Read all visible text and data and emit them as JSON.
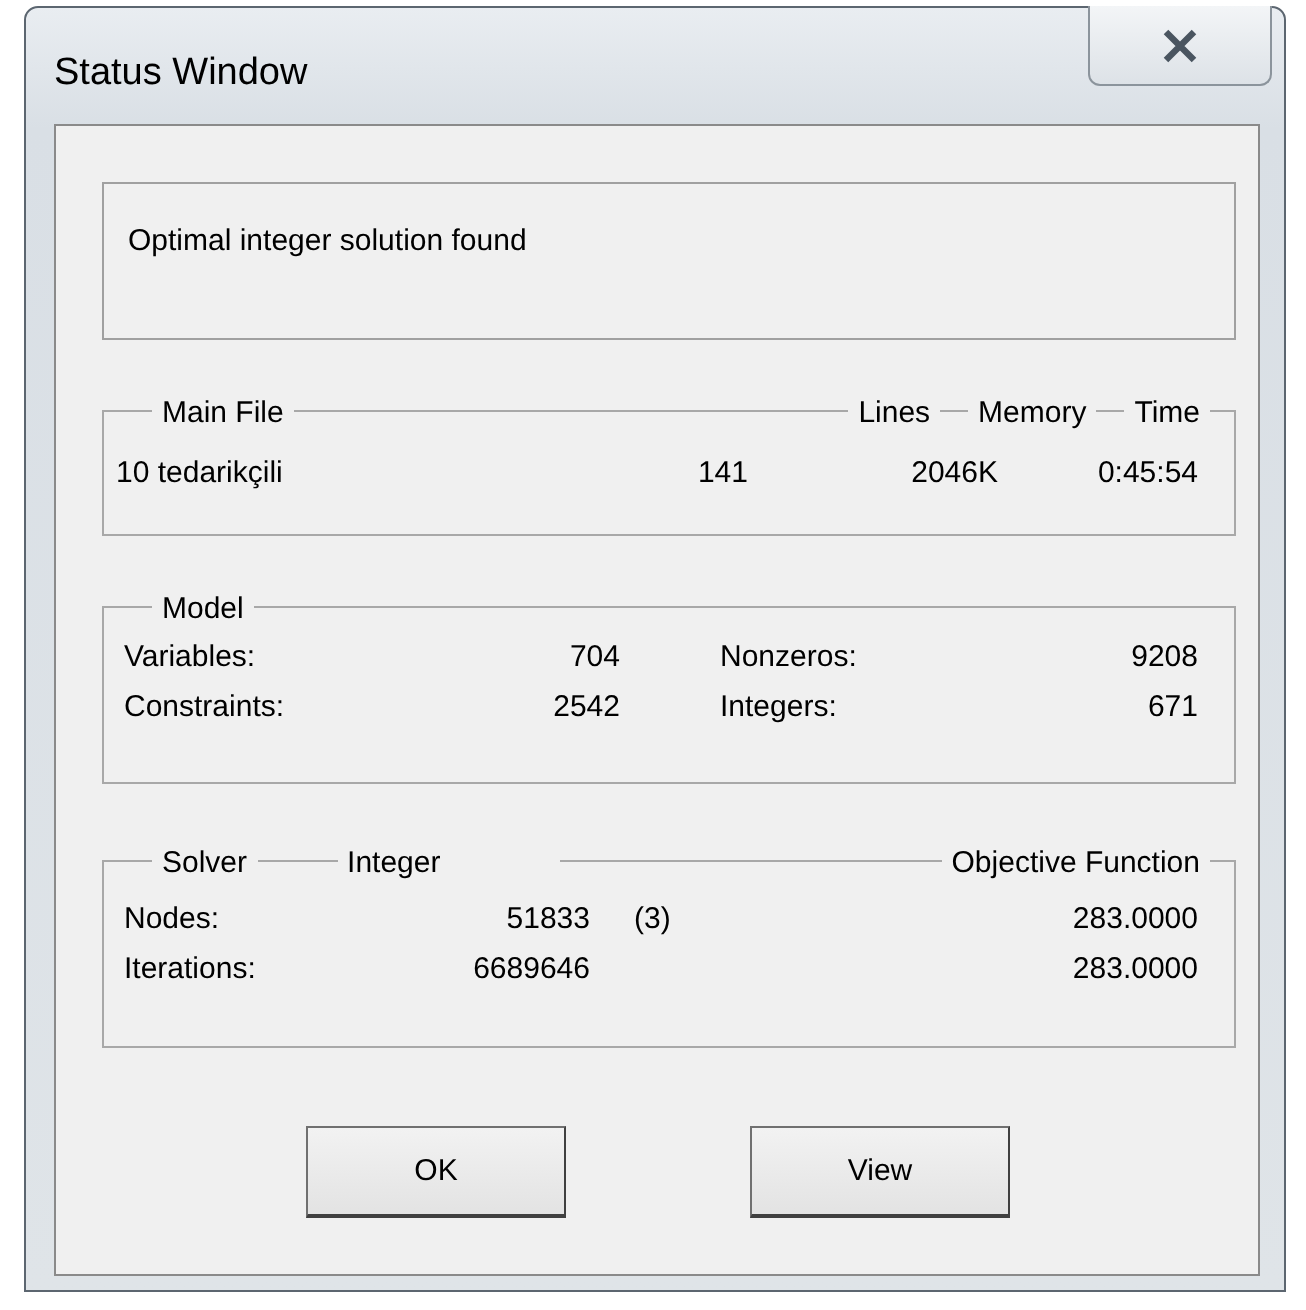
{
  "window": {
    "title": "Status Window"
  },
  "message": "Optimal integer solution found",
  "file_group": {
    "headers": [
      "Main File",
      "Lines",
      "Memory",
      "Time"
    ],
    "values": [
      "10 tedarikçili",
      "141",
      "2046K",
      "0:45:54"
    ]
  },
  "model_group": {
    "title": "Model",
    "rows": [
      {
        "label": "Variables:",
        "value": "704",
        "label2": "Nonzeros:",
        "value2": "9208"
      },
      {
        "label": "Constraints:",
        "value": "2542",
        "label2": "Integers:",
        "value2": "671"
      }
    ]
  },
  "solver_group": {
    "headers": [
      "Solver",
      "Integer",
      "Objective Function"
    ],
    "rows": [
      {
        "label": "Nodes:",
        "value": "51833",
        "extra": "(3)",
        "objective": "283.0000"
      },
      {
        "label": "Iterations:",
        "value": "6689646",
        "objective": "283.0000"
      }
    ]
  },
  "buttons": [
    "OK",
    "View"
  ]
}
